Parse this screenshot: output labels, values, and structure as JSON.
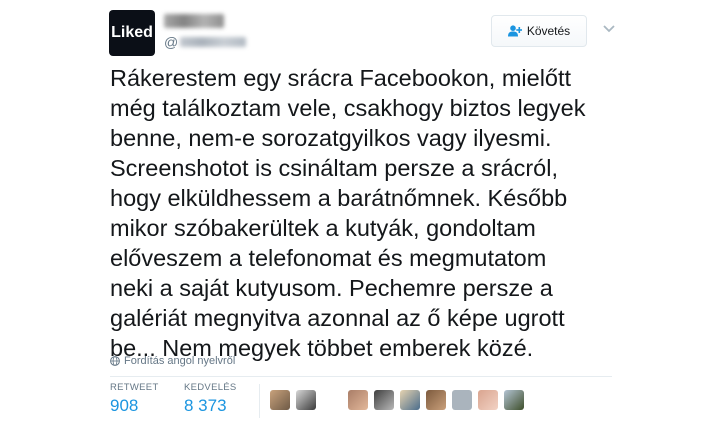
{
  "header": {
    "avatar_text": "Liked",
    "handle_prefix": "@",
    "follow_label": "Követés"
  },
  "tweet": {
    "lines": [
      "Rákerestem egy srácra Facebookon, mielőtt",
      "még találkoztam vele, csakhogy biztos legyek",
      "benne, nem-e sorozatgyilkos vagy ilyesmi.",
      "Screenshotot is csináltam persze a srácról,",
      "hogy elküldhessem a barátnőmnek. Később",
      "mikor szóbakerültek a kutyák, gondoltam",
      "előveszem a telefonomat és megmutatom",
      "neki a saját kutyusom. Pechemre persze a",
      "galériát megnyitva azonnal az ő képe ugrott",
      "be... Nem megyek többet emberek közé."
    ],
    "translate_label": "Fordítás angol nyelvről"
  },
  "stats": {
    "retweet_label": "RETWEET",
    "retweet_value": "908",
    "likes_label": "KEDVELÉS",
    "likes_value": "8 373"
  },
  "colors": {
    "accent": "#1b95e0",
    "muted": "#657786",
    "text": "#14171a",
    "avatar_bg": "#0b0f17"
  },
  "icons": {
    "follow": "person-plus-icon",
    "menu": "chevron-down-icon",
    "translate": "globe-icon"
  }
}
